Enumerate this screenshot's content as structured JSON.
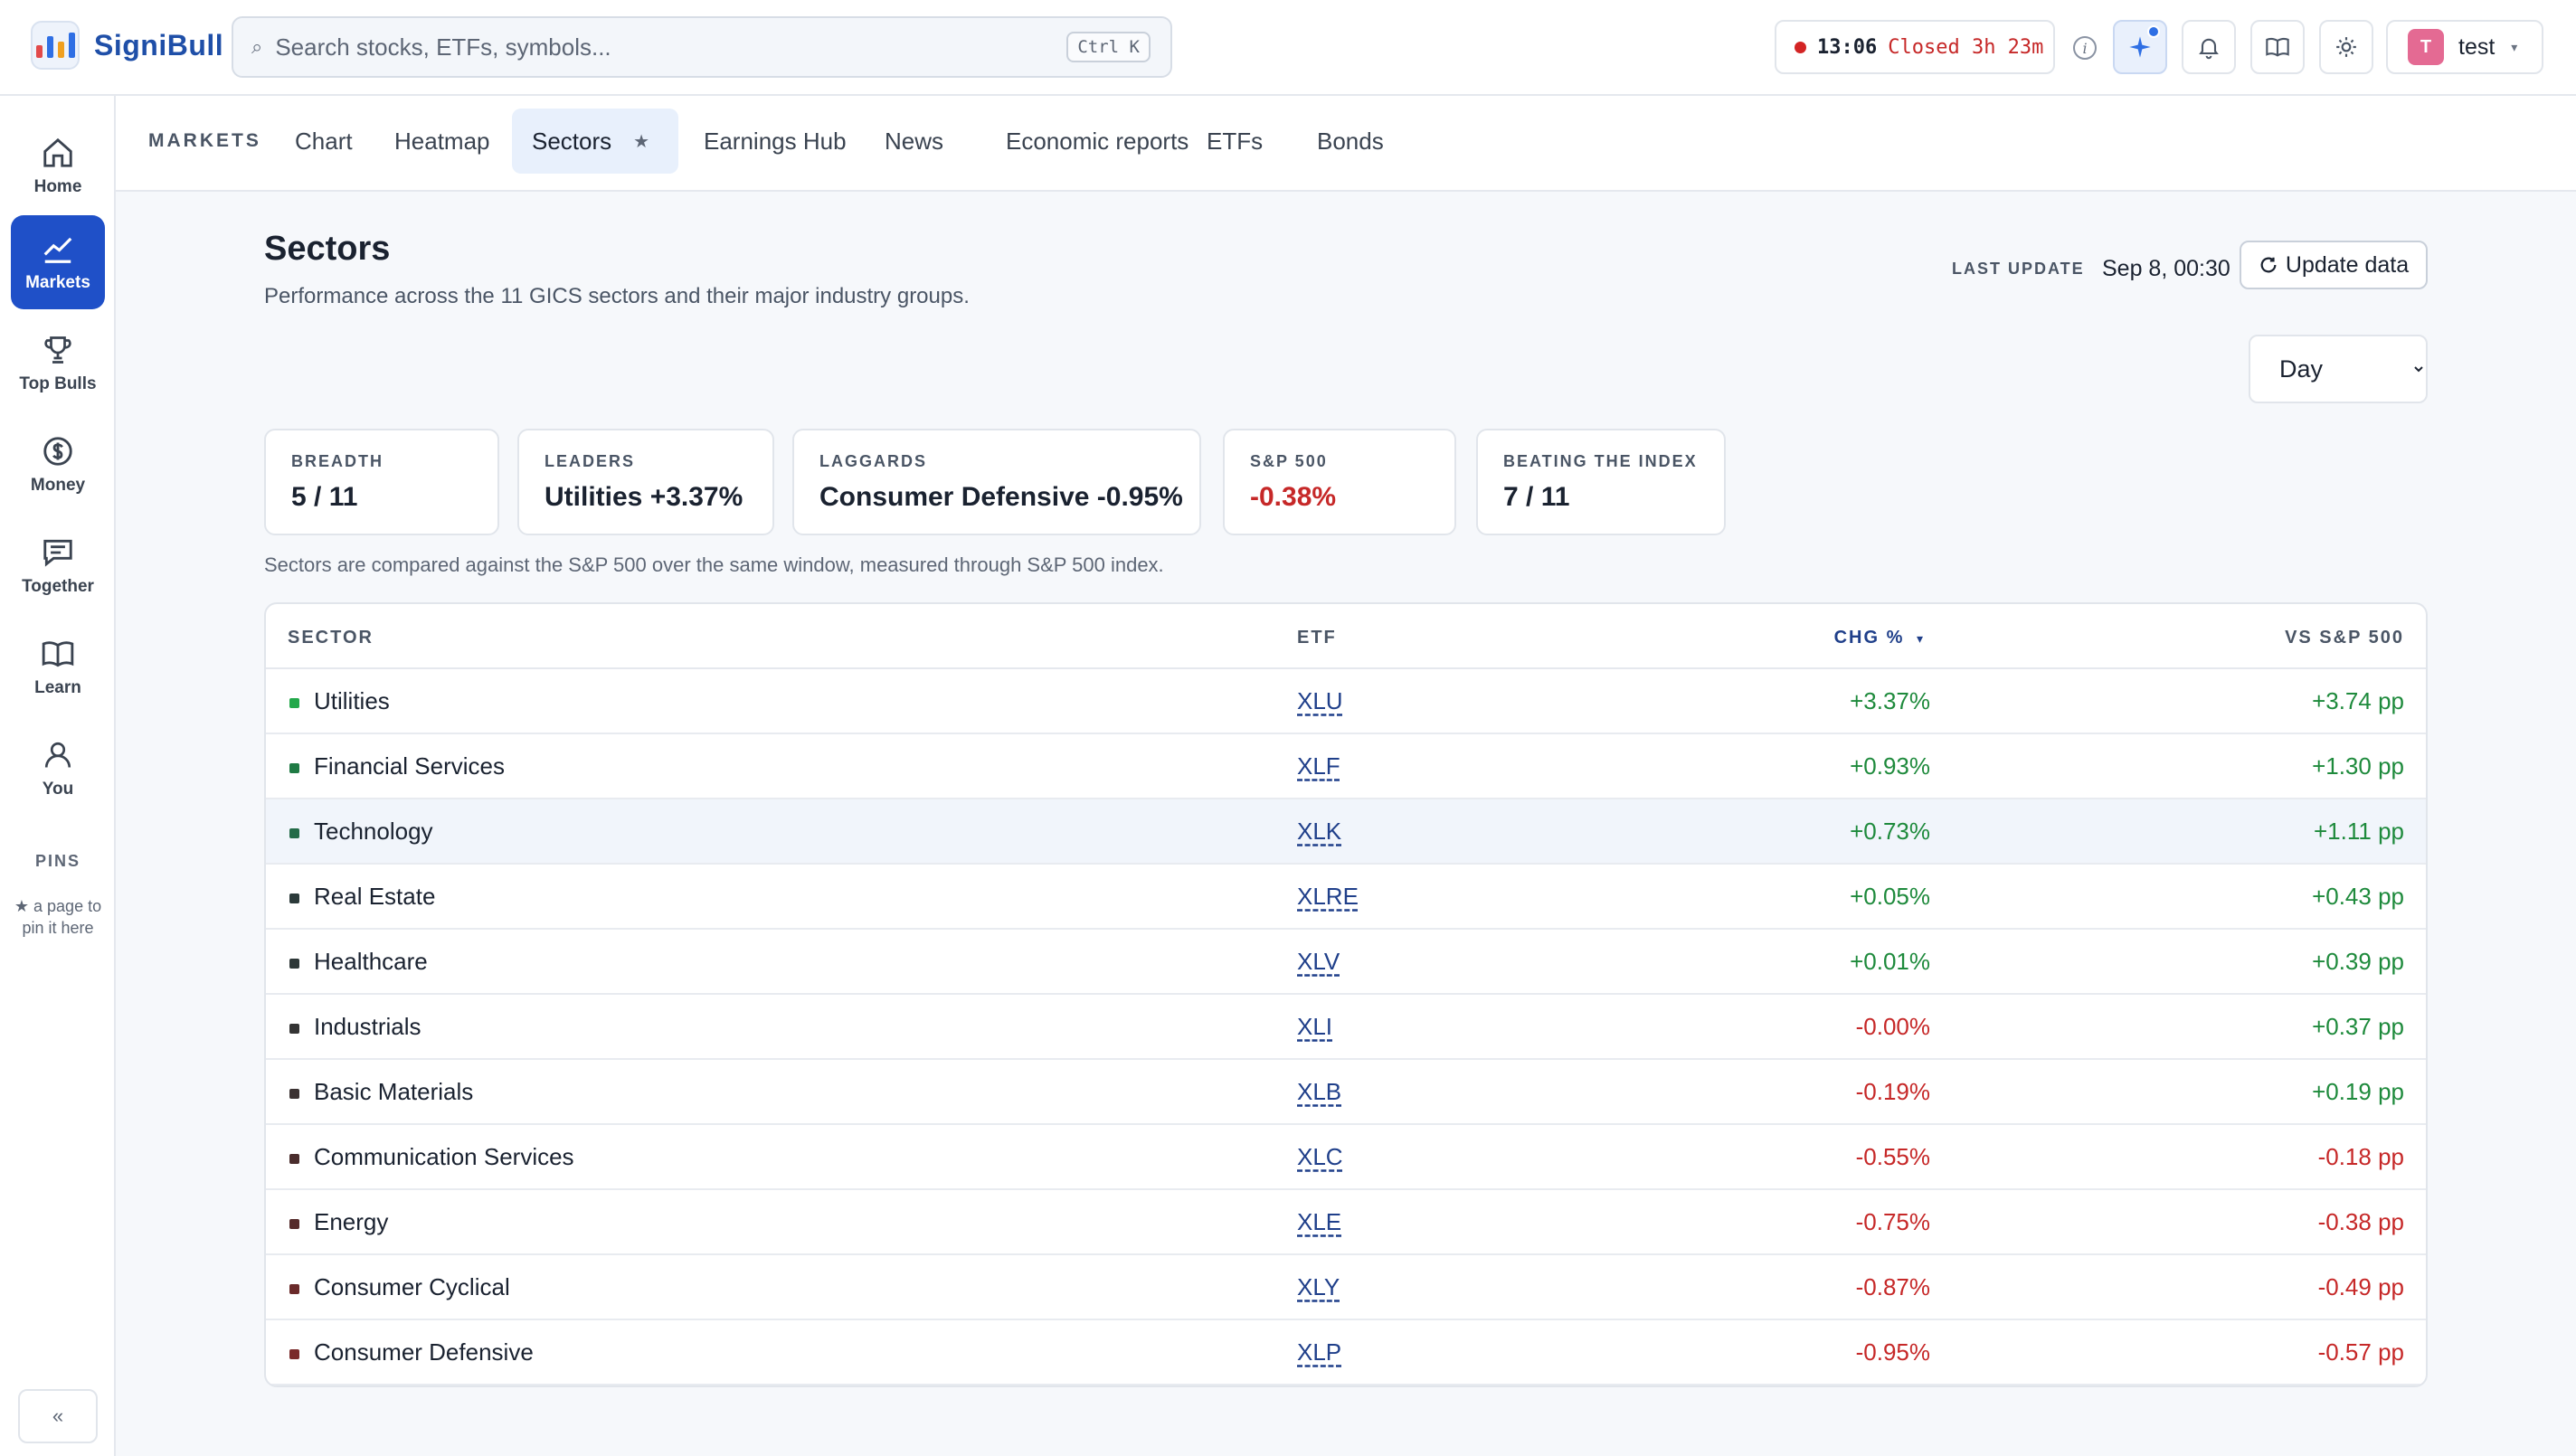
{
  "brand": {
    "name": "SigniBull"
  },
  "search": {
    "placeholder": "Search stocks, ETFs, symbols...",
    "shortcut": "Ctrl K"
  },
  "market_clock": {
    "time": "13:06",
    "status": "Closed 3h 23m"
  },
  "user": {
    "initial": "T",
    "name": "test"
  },
  "sidebar": {
    "items": [
      {
        "label": "Home",
        "icon": "home-icon"
      },
      {
        "label": "Markets",
        "icon": "chart-line-icon",
        "active": true
      },
      {
        "label": "Top Bulls",
        "icon": "trophy-icon"
      },
      {
        "label": "Money",
        "icon": "coin-icon"
      },
      {
        "label": "Together",
        "icon": "chat-icon"
      },
      {
        "label": "Learn",
        "icon": "book-icon"
      },
      {
        "label": "You",
        "icon": "user-icon"
      }
    ],
    "pins_title": "PINS",
    "pins_hint": "★ a page to pin it here",
    "collapse_label": "«"
  },
  "subnav": {
    "title": "MARKETS",
    "tabs": [
      "Chart",
      "Heatmap",
      "Sectors",
      "Earnings Hub",
      "News",
      "Economic reports",
      "ETFs",
      "Bonds"
    ],
    "active_tab": "Sectors"
  },
  "page": {
    "title": "Sectors",
    "subtitle": "Performance across the 11 GICS sectors and their major industry groups.",
    "last_update_label": "LAST UPDATE",
    "last_update_value": "Sep 8, 00:30",
    "update_button": "Update data",
    "period_options": [
      "Day"
    ],
    "period_selected": "Day",
    "note": "Sectors are compared against the S&P 500 over the same window, measured through S&P 500 index."
  },
  "stats": [
    {
      "label": "BREADTH",
      "value": "5 / 11"
    },
    {
      "label": "LEADERS",
      "value": "Utilities +3.37%"
    },
    {
      "label": "LAGGARDS",
      "value": "Consumer Defensive -0.95%"
    },
    {
      "label": "S&P 500",
      "value": "-0.38%",
      "negative": true
    },
    {
      "label": "BEATING THE INDEX",
      "value": "7 / 11"
    }
  ],
  "table": {
    "headers": {
      "sector": "SECTOR",
      "etf": "ETF",
      "chg": "CHG %",
      "sort_indicator": "▾",
      "vs": "VS S&P 500"
    },
    "rows": [
      {
        "sector": "Utilities",
        "etf": "XLU",
        "chg": "+3.37%",
        "vs": "+3.74 pp",
        "dot": "#22a84a"
      },
      {
        "sector": "Financial Services",
        "etf": "XLF",
        "chg": "+0.93%",
        "vs": "+1.30 pp",
        "dot": "#1f7a44"
      },
      {
        "sector": "Technology",
        "etf": "XLK",
        "chg": "+0.73%",
        "vs": "+1.11 pp",
        "dot": "#236b48"
      },
      {
        "sector": "Real Estate",
        "etf": "XLRE",
        "chg": "+0.05%",
        "vs": "+0.43 pp",
        "dot": "#2b3a3a"
      },
      {
        "sector": "Healthcare",
        "etf": "XLV",
        "chg": "+0.01%",
        "vs": "+0.39 pp",
        "dot": "#2e3838"
      },
      {
        "sector": "Industrials",
        "etf": "XLI",
        "chg": "-0.00%",
        "vs": "+0.37 pp",
        "dot": "#343434"
      },
      {
        "sector": "Basic Materials",
        "etf": "XLB",
        "chg": "-0.19%",
        "vs": "+0.19 pp",
        "dot": "#3b3232"
      },
      {
        "sector": "Communication Services",
        "etf": "XLC",
        "chg": "-0.55%",
        "vs": "-0.18 pp",
        "dot": "#4a2d2d"
      },
      {
        "sector": "Energy",
        "etf": "XLE",
        "chg": "-0.75%",
        "vs": "-0.38 pp",
        "dot": "#552a2a"
      },
      {
        "sector": "Consumer Cyclical",
        "etf": "XLY",
        "chg": "-0.87%",
        "vs": "-0.49 pp",
        "dot": "#6a2a2a"
      },
      {
        "sector": "Consumer Defensive",
        "etf": "XLP",
        "chg": "-0.95%",
        "vs": "-0.57 pp",
        "dot": "#7a2a2a"
      }
    ]
  },
  "colors": {
    "accent": "#1f50c8",
    "positive": "#1e8a3c",
    "negative": "#c62828"
  }
}
